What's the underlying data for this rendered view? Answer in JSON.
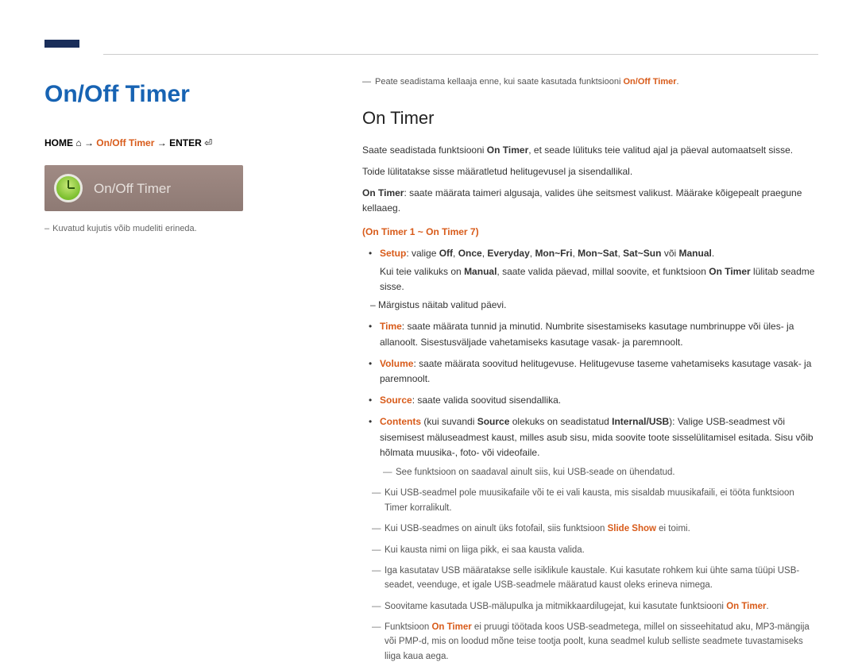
{
  "left": {
    "title": "On/Off Timer",
    "breadcrumb": {
      "home": "HOME",
      "arrow1": "→",
      "item": "On/Off Timer",
      "arrow2": "→",
      "enter": "ENTER"
    },
    "screenshot_label": "On/Off Timer",
    "caption": "Kuvatud kujutis võib mudeliti erineda."
  },
  "right": {
    "topnote_prefix": "Peate seadistama kellaaja enne, kui saate kasutada funktsiooni ",
    "topnote_bold": "On/Off Timer",
    "section_title": "On Timer",
    "p1_a": "Saate seadistada funktsiooni ",
    "p1_bold": "On Timer",
    "p1_b": ", et seade lülituks teie valitud ajal ja päeval automaatselt sisse.",
    "p2": "Toide lülitatakse sisse määratletud helitugevusel ja sisendallikal.",
    "p3_bold": "On Timer",
    "p3_rest": ": saate määrata taimeri algusaja, valides ühe seitsmest valikust. Määrake kõigepealt praegune kellaaeg.",
    "subhead": "(On Timer 1 ~ On Timer 7)",
    "bul_setup": {
      "key": "Setup",
      "mid": ": valige ",
      "opts": [
        "Off",
        "Once",
        "Everyday",
        "Mon~Fri",
        "Mon~Sat",
        "Sat~Sun"
      ],
      "or": " või ",
      "manual": "Manual",
      "sub1_a": "Kui teie valikuks on ",
      "sub1_b": ", saate valida päevad, millal soovite, et funktsioon ",
      "sub1_on": "On Timer",
      "sub1_c": " lülitab seadme sisse.",
      "sub2": "Märgistus näitab valitud päevi."
    },
    "bul_time": {
      "key": "Time",
      "text": ": saate määrata tunnid ja minutid. Numbrite sisestamiseks kasutage numbrinuppe või üles- ja allanoolt. Sisestusväljade vahetamiseks kasutage vasak- ja paremnoolt."
    },
    "bul_volume": {
      "key": "Volume",
      "text": ": saate määrata soovitud helitugevuse. Helitugevuse taseme vahetamiseks kasutage vasak- ja paremnoolt."
    },
    "bul_source": {
      "key": "Source",
      "text": ": saate valida soovitud sisendallika."
    },
    "bul_contents": {
      "key": "Contents",
      "mid": " (kui suvandi ",
      "src": "Source",
      "mid2": " olekuks on seadistatud ",
      "iu": "Internal/USB",
      "rest": "): Valige USB-seadmest või sisemisest mäluseadmest kaust, milles asub sisu, mida soovite toote sisselülitamisel esitada. Sisu võib hõlmata muusika-, foto- või videofaile."
    },
    "dashed": {
      "d1": "See funktsioon on saadaval ainult siis, kui USB-seade on ühendatud.",
      "d2": "Kui USB-seadmel pole muusikafaile või te ei vali kausta, mis sisaldab muusikafaili, ei tööta funktsioon Timer korralikult.",
      "d3_a": "Kui USB-seadmes on ainult üks fotofail, siis funktsioon ",
      "d3_slide": "Slide Show",
      "d3_b": " ei toimi.",
      "d4": "Kui kausta nimi on liiga pikk, ei saa kausta valida.",
      "d5": "Iga kasutatav USB määratakse selle isiklikule kaustale. Kui kasutate rohkem kui ühte sama tüüpi USB-seadet, veenduge, et igale USB-seadmele määratud kaust oleks erineva nimega.",
      "d6_a": "Soovitame kasutada USB-mälupulka ja mitmikkaardilugejat, kui kasutate funktsiooni ",
      "d6_on": "On Timer",
      "d7_a": "Funktsioon ",
      "d7_on": "On Timer",
      "d7_b": " ei pruugi töötada koos USB-seadmetega, millel on sisseehitatud aku, MP3-mängija või PMP-d, mis on loodud mõne teise tootja poolt, kuna seadmel kulub selliste seadmete tuvastamiseks liiga kaua aega."
    }
  }
}
